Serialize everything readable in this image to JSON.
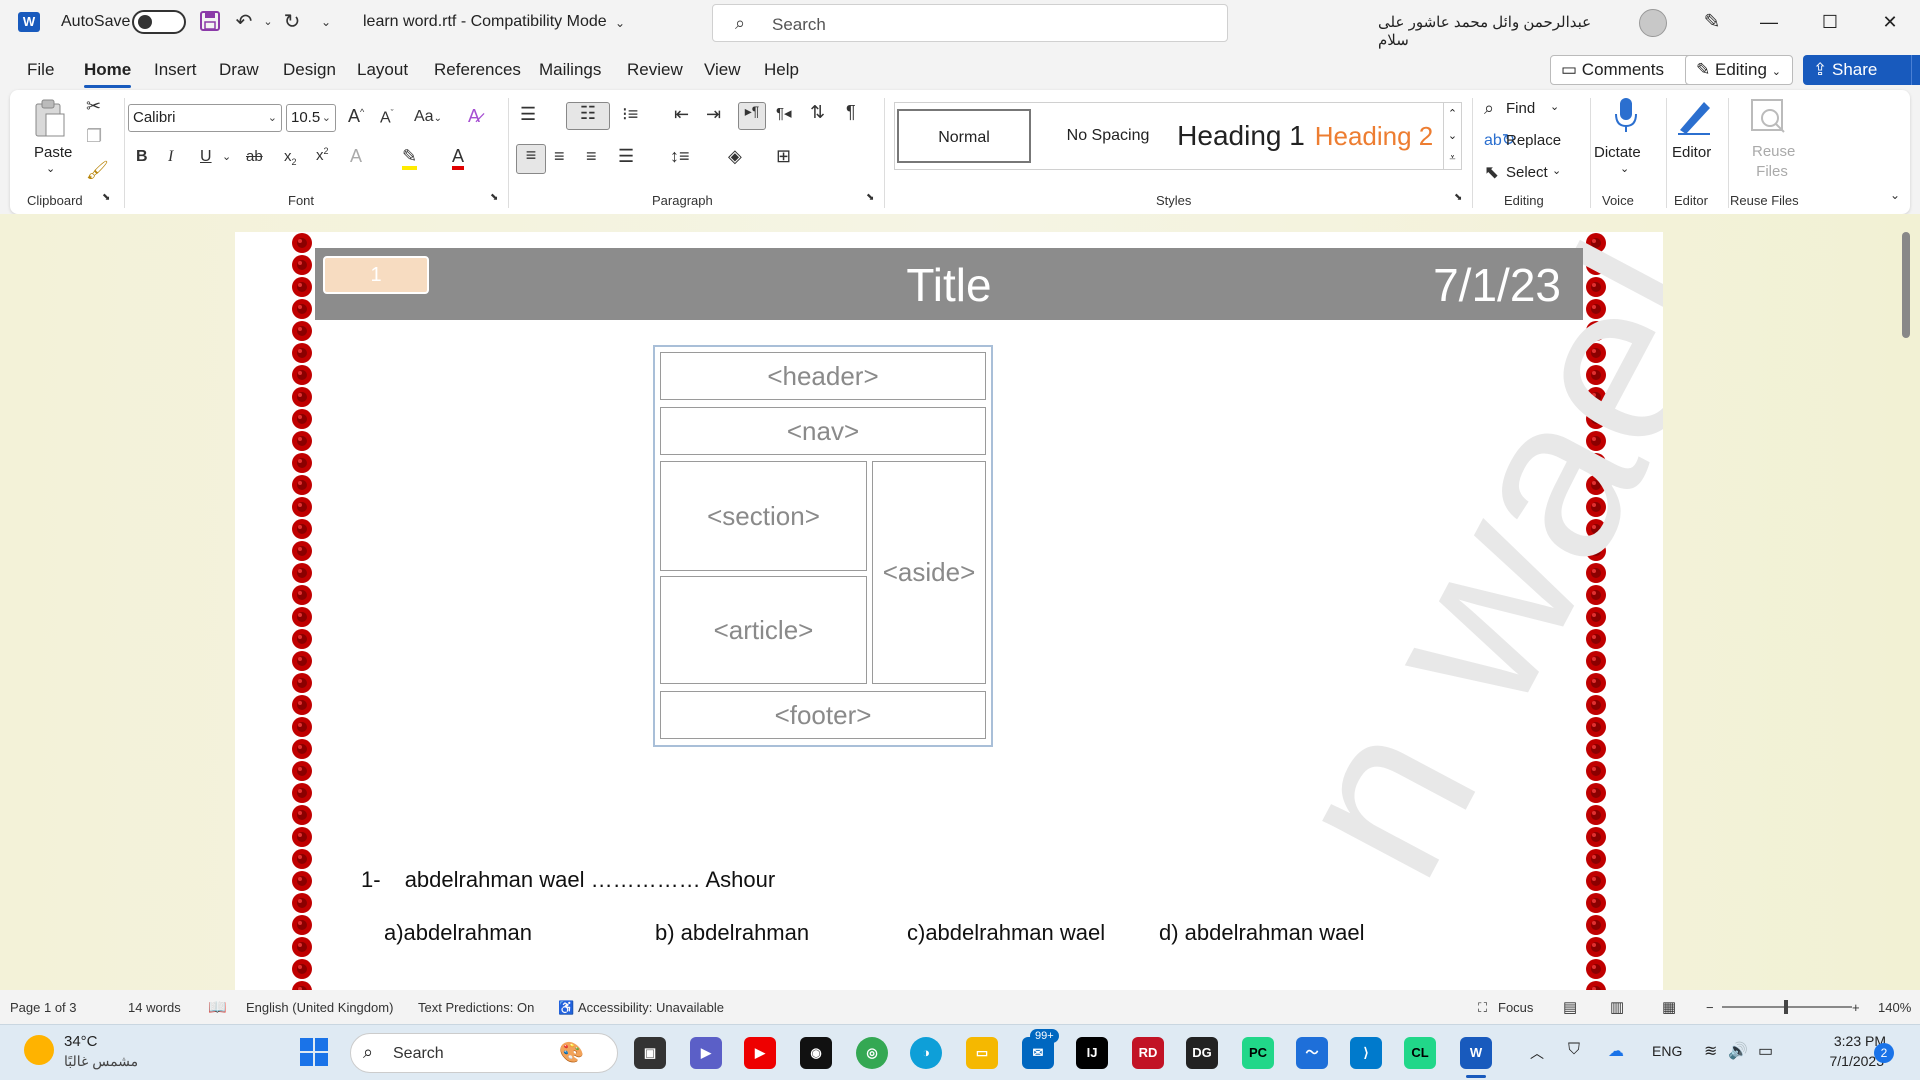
{
  "titlebar": {
    "autosave_label": "AutoSave",
    "doc_title": "learn word.rtf  -  Compatibility Mode",
    "search_placeholder": "Search",
    "user_name": "عبدالرحمن وائل محمد عاشور على سلام",
    "minimize": "—",
    "maximize": "☐",
    "close": "✕"
  },
  "menu": {
    "tabs": [
      "File",
      "Home",
      "Insert",
      "Draw",
      "Design",
      "Layout",
      "References",
      "Mailings",
      "Review",
      "View",
      "Help"
    ],
    "comments_label": "Comments",
    "editing_label": "Editing",
    "share_label": "Share"
  },
  "ribbon": {
    "clipboard": {
      "paste_label": "Paste",
      "group_label": "Clipboard"
    },
    "font": {
      "font_name": "Calibri",
      "font_size": "10.5",
      "group_label": "Font",
      "change_case": "Aa"
    },
    "paragraph": {
      "group_label": "Paragraph"
    },
    "styles": {
      "group_label": "Styles",
      "items": [
        "Normal",
        "No Spacing",
        "Heading 1",
        "Heading 2"
      ]
    },
    "editing": {
      "find": "Find",
      "replace": "Replace",
      "select": "Select",
      "group_label": "Editing"
    },
    "voice": {
      "dictate": "Dictate",
      "group_label": "Voice"
    },
    "editor": {
      "editor": "Editor",
      "group_label": "Editor"
    },
    "reuse": {
      "label": "Reuse Files",
      "group_label": "Reuse Files"
    }
  },
  "document": {
    "page_number": "1",
    "header_title": "Title",
    "header_date": "7/1/23",
    "watermark": "n wael",
    "diagram": {
      "header": "<header>",
      "nav": "<nav>",
      "section": "<section>",
      "article": "<article>",
      "aside": "<aside>",
      "footer": "<footer>"
    },
    "question_number": "1-",
    "question_text": "abdelrahman wael …………… Ashour",
    "options": [
      "a)abdelrahman",
      "b) abdelrahman",
      "c)abdelrahman wael",
      "d) abdelrahman wael"
    ]
  },
  "statusbar": {
    "page": "Page 1 of 3",
    "words": "14 words",
    "language": "English (United Kingdom)",
    "predictions": "Text Predictions: On",
    "accessibility": "Accessibility: Unavailable",
    "focus": "Focus",
    "zoom": "140%"
  },
  "taskbar": {
    "weather_temp": "34°C",
    "weather_desc": "مشمس غالبًا",
    "search_label": "Search",
    "notification_badge": "99+",
    "language": "ENG",
    "time": "3:23 PM",
    "date": "7/1/2023",
    "notif_count": "2"
  },
  "colors": {
    "accent": "#185abd",
    "header_band": "#8c8c8c",
    "page_num_fill": "#f7dcc1",
    "heading2": "#ed7d31",
    "doc_bg": "#f3f2d8"
  }
}
